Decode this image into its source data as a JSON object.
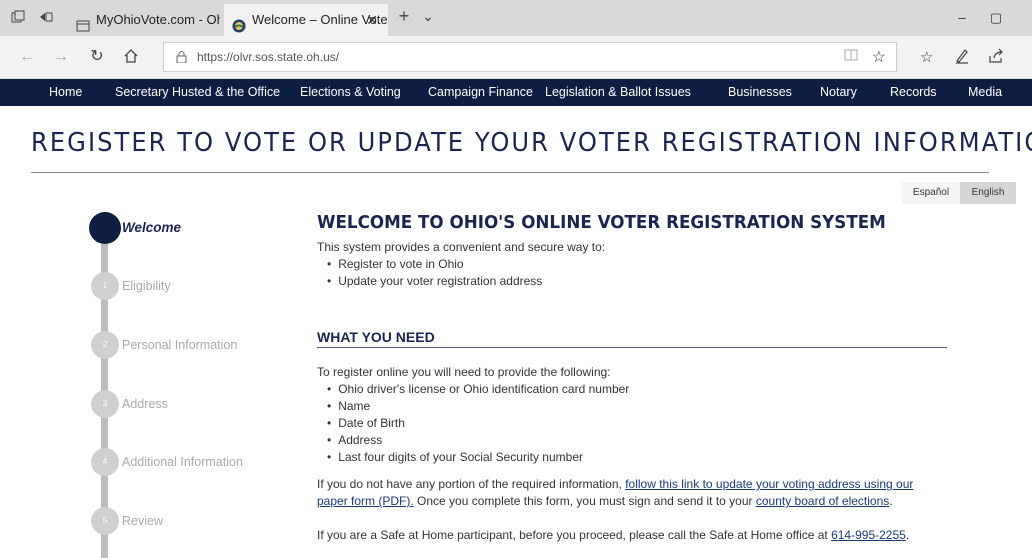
{
  "browser": {
    "tabs": [
      {
        "title": "MyOhioVote.com - Ohio Se",
        "active": false
      },
      {
        "title": "Welcome – Online Vote",
        "active": true
      }
    ],
    "new_tab_label": "+",
    "tab_list_label": "⌄",
    "close_tab_label": "✕",
    "url": "https://olvr.sos.state.oh.us/",
    "window_buttons": {
      "minimize": "–",
      "restore": "▢"
    }
  },
  "site_nav": {
    "items": [
      "Home",
      "Secretary Husted & the Office",
      "Elections & Voting",
      "Campaign Finance",
      "Legislation & Ballot Issues",
      "Businesses",
      "Notary",
      "Records",
      "Media"
    ]
  },
  "page": {
    "title": "REGISTER TO VOTE OR UPDATE YOUR VOTER REGISTRATION INFORMATION",
    "languages": {
      "spanish": "Español",
      "english": "English"
    }
  },
  "stepper": {
    "current": "Welcome",
    "steps": [
      {
        "num": "1",
        "label": "Eligibility"
      },
      {
        "num": "2",
        "label": "Personal Information"
      },
      {
        "num": "3",
        "label": "Address"
      },
      {
        "num": "4",
        "label": "Additional Information"
      },
      {
        "num": "5",
        "label": "Review"
      }
    ]
  },
  "content": {
    "welcome_heading": "WELCOME TO OHIO'S ONLINE VOTER REGISTRATION SYSTEM",
    "intro": "This system provides a convenient and secure way to:",
    "intro_bullets": [
      "Register to vote in Ohio",
      "Update your voter registration address"
    ],
    "need_heading": "WHAT YOU NEED",
    "need_intro": "To register online you will need to provide the following:",
    "need_bullets": [
      "Ohio driver's license or Ohio identification card number",
      "Name",
      "Date of Birth",
      "Address",
      "Last four digits of your Social Security number"
    ],
    "missing_prefix": "If you do not have any portion of the required information, ",
    "missing_link_line1": "follow this link to update your voting address using our",
    "missing_link_line2": "paper form (PDF).",
    "missing_middle": " Once you complete this form, you must sign and send it to your ",
    "county_link": "county board of elections",
    "missing_end": ".",
    "safe_prefix": "If you are a Safe at Home participant, before you proceed, please call the Safe at Home office at ",
    "safe_phone": "614-995-2255",
    "safe_end": "."
  }
}
